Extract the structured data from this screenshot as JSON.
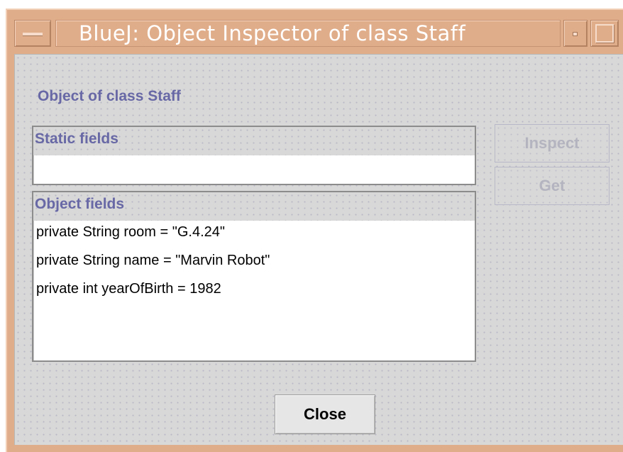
{
  "window": {
    "title": "BlueJ:  Object Inspector of class Staff",
    "accent_color": "#e0ad8a"
  },
  "titlebar_icons": {
    "menu": "window-menu-icon",
    "minimize": "minimize-icon",
    "maximize": "maximize-icon"
  },
  "inspector": {
    "object_label": "Object of class Staff",
    "static_fields": {
      "header": "Static fields",
      "items": []
    },
    "object_fields": {
      "header": "Object fields",
      "items": [
        "private String room = \"G.4.24\"",
        "private String name = \"Marvin Robot\"",
        "private int yearOfBirth = 1982"
      ]
    }
  },
  "buttons": {
    "inspect": "Inspect",
    "get": "Get",
    "close": "Close"
  }
}
